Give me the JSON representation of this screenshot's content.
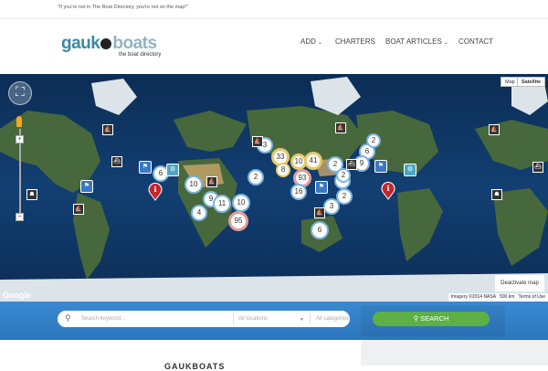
{
  "tagline": "\"If you're not in The Boat Directory, you're not on the map!\"",
  "logo": {
    "part1": "gauk",
    "part2": "boats",
    "subtitle": "the boat directory"
  },
  "nav": {
    "items": [
      {
        "label": "ADD",
        "has_dropdown": true
      },
      {
        "label": "CHARTERS",
        "has_dropdown": false
      },
      {
        "label": "BOAT ARTICLES",
        "has_dropdown": true
      },
      {
        "label": "CONTACT",
        "has_dropdown": false
      }
    ],
    "chevron": "⌄"
  },
  "map": {
    "type_buttons": [
      "Map",
      "Satellite"
    ],
    "zoom_in": "+",
    "zoom_out": "−",
    "google_label": "Google",
    "attribution": "Imagery ©2014 NASA",
    "scale": "500 km",
    "terms": "Terms of Use",
    "deactivate_label": "Deactivate map",
    "clusters": [
      "3",
      "33",
      "10",
      "41",
      "2",
      "6",
      "2",
      "9",
      "8",
      "2",
      "93",
      "16",
      "10",
      "4",
      "9",
      "11",
      "10",
      "4",
      "95",
      "2",
      "3",
      "6",
      "6",
      "2"
    ]
  },
  "search": {
    "keyword_placeholder": "Search keyword...",
    "location_placeholder": "All locations",
    "category_placeholder": "All categories",
    "button_label": "SEARCH"
  },
  "below": {
    "title": "GAUKBOATS"
  },
  "colors": {
    "brand_blue": "#3a8aa3",
    "search_bar": "#2c76be",
    "search_button": "#5cb046"
  }
}
